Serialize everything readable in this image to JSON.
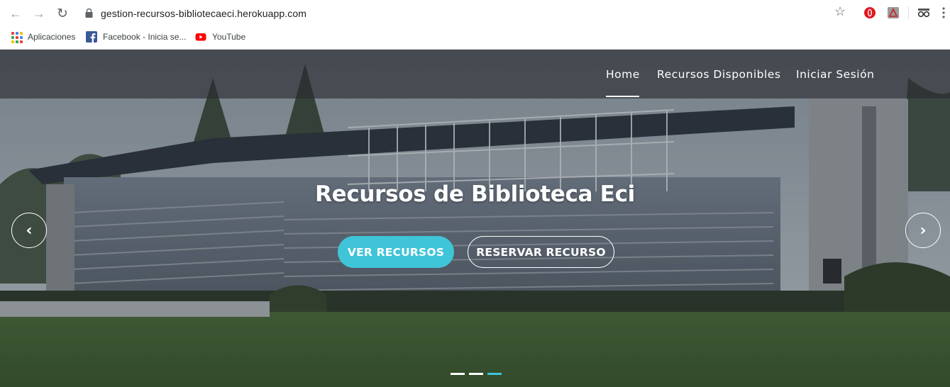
{
  "browser": {
    "url": "gestion-recursos-bibliotecaeci.herokuapp.com",
    "bookmarks": [
      {
        "label": "Aplicaciones",
        "icon": "apps-grid-icon"
      },
      {
        "label": "Facebook - Inicia se...",
        "icon": "facebook-icon"
      },
      {
        "label": "YouTube",
        "icon": "youtube-icon"
      }
    ],
    "extensions": [
      "opera-extension-icon",
      "pdf-extension-icon",
      "glasses-extension-icon"
    ]
  },
  "site": {
    "nav": {
      "home": "Home",
      "recursos": "Recursos Disponibles",
      "login": "Iniciar Sesión",
      "active": "home"
    },
    "hero": {
      "title": "Recursos de Biblioteca Eci",
      "primary_button": "VER RECURSOS",
      "secondary_button": "RESERVAR RECURSO",
      "prev_symbol": "‹",
      "next_symbol": "›",
      "slides": 3,
      "active_slide": 3
    }
  },
  "colors": {
    "accent": "#3fc4d8",
    "nav_bg": "#2a2c30",
    "text": "#ffffff"
  }
}
